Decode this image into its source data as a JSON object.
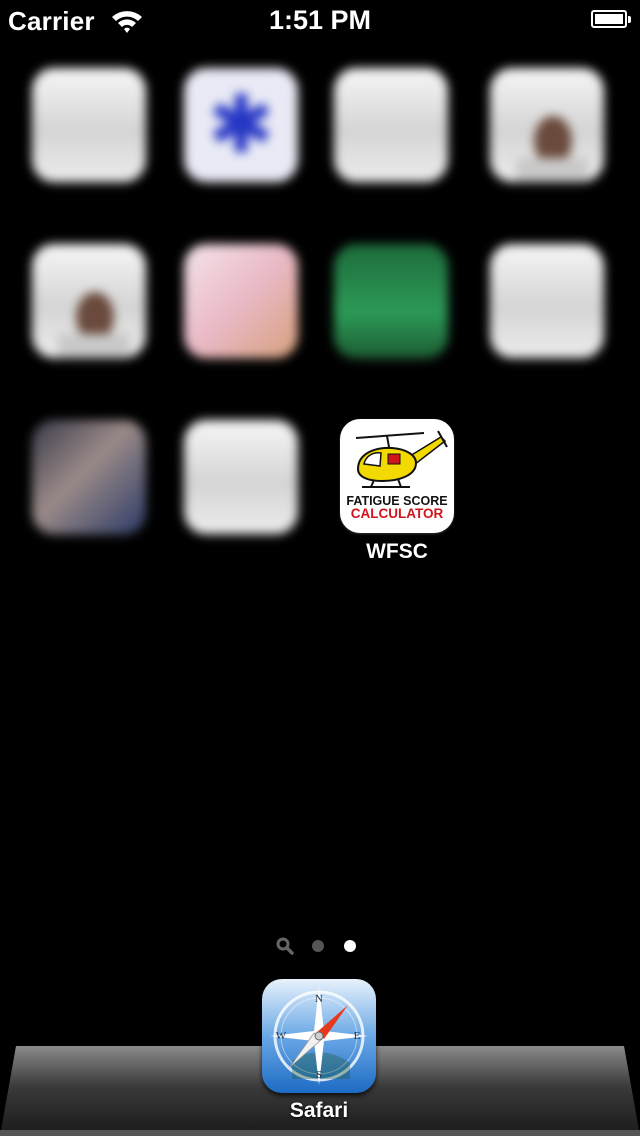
{
  "status_bar": {
    "carrier": "Carrier",
    "time": "1:51 PM",
    "battery_level": 1.0
  },
  "home": {
    "apps": [
      {
        "label": "",
        "blurred": true
      },
      {
        "label": "",
        "blurred": true
      },
      {
        "label": "",
        "blurred": true
      },
      {
        "label": "",
        "blurred": true
      },
      {
        "label": "",
        "blurred": true
      },
      {
        "label": "",
        "blurred": true
      },
      {
        "label": "",
        "blurred": true
      },
      {
        "label": "",
        "blurred": true
      },
      {
        "label": "",
        "blurred": true
      },
      {
        "label": "",
        "blurred": true
      }
    ],
    "featured_app": {
      "label": "WFSC",
      "icon_line1": "FATIGUE SCORE",
      "icon_line2": "CALCULATOR",
      "accent": "#d0151c"
    }
  },
  "page_indicator": {
    "pages": 2,
    "current_page": 2
  },
  "dock": {
    "apps": [
      {
        "label": "Safari",
        "icon": "compass-icon"
      }
    ]
  },
  "colors": {
    "background": "#000000",
    "heli_yellow": "#f2d900",
    "calculator_red": "#d0151c"
  }
}
